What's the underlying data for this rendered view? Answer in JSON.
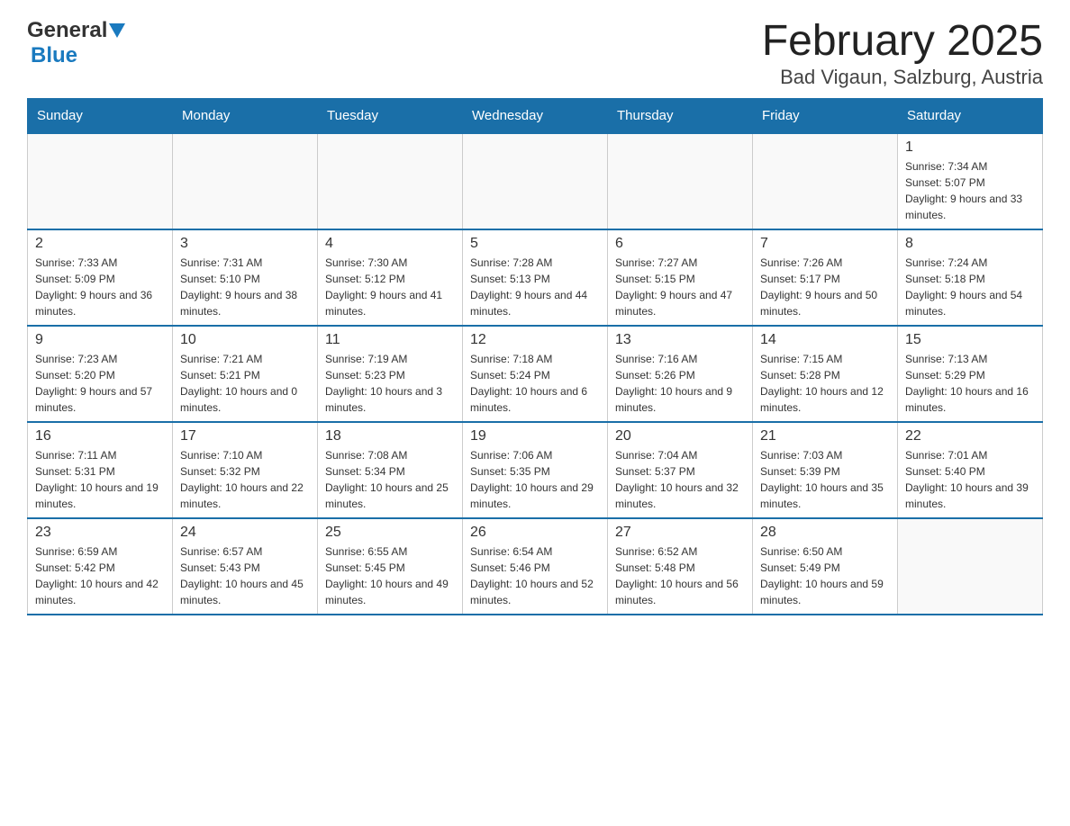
{
  "header": {
    "logo": {
      "general": "General",
      "blue": "Blue"
    },
    "title": "February 2025",
    "subtitle": "Bad Vigaun, Salzburg, Austria"
  },
  "weekdays": [
    "Sunday",
    "Monday",
    "Tuesday",
    "Wednesday",
    "Thursday",
    "Friday",
    "Saturday"
  ],
  "weeks": [
    [
      {
        "day": "",
        "info": ""
      },
      {
        "day": "",
        "info": ""
      },
      {
        "day": "",
        "info": ""
      },
      {
        "day": "",
        "info": ""
      },
      {
        "day": "",
        "info": ""
      },
      {
        "day": "",
        "info": ""
      },
      {
        "day": "1",
        "info": "Sunrise: 7:34 AM\nSunset: 5:07 PM\nDaylight: 9 hours and 33 minutes."
      }
    ],
    [
      {
        "day": "2",
        "info": "Sunrise: 7:33 AM\nSunset: 5:09 PM\nDaylight: 9 hours and 36 minutes."
      },
      {
        "day": "3",
        "info": "Sunrise: 7:31 AM\nSunset: 5:10 PM\nDaylight: 9 hours and 38 minutes."
      },
      {
        "day": "4",
        "info": "Sunrise: 7:30 AM\nSunset: 5:12 PM\nDaylight: 9 hours and 41 minutes."
      },
      {
        "day": "5",
        "info": "Sunrise: 7:28 AM\nSunset: 5:13 PM\nDaylight: 9 hours and 44 minutes."
      },
      {
        "day": "6",
        "info": "Sunrise: 7:27 AM\nSunset: 5:15 PM\nDaylight: 9 hours and 47 minutes."
      },
      {
        "day": "7",
        "info": "Sunrise: 7:26 AM\nSunset: 5:17 PM\nDaylight: 9 hours and 50 minutes."
      },
      {
        "day": "8",
        "info": "Sunrise: 7:24 AM\nSunset: 5:18 PM\nDaylight: 9 hours and 54 minutes."
      }
    ],
    [
      {
        "day": "9",
        "info": "Sunrise: 7:23 AM\nSunset: 5:20 PM\nDaylight: 9 hours and 57 minutes."
      },
      {
        "day": "10",
        "info": "Sunrise: 7:21 AM\nSunset: 5:21 PM\nDaylight: 10 hours and 0 minutes."
      },
      {
        "day": "11",
        "info": "Sunrise: 7:19 AM\nSunset: 5:23 PM\nDaylight: 10 hours and 3 minutes."
      },
      {
        "day": "12",
        "info": "Sunrise: 7:18 AM\nSunset: 5:24 PM\nDaylight: 10 hours and 6 minutes."
      },
      {
        "day": "13",
        "info": "Sunrise: 7:16 AM\nSunset: 5:26 PM\nDaylight: 10 hours and 9 minutes."
      },
      {
        "day": "14",
        "info": "Sunrise: 7:15 AM\nSunset: 5:28 PM\nDaylight: 10 hours and 12 minutes."
      },
      {
        "day": "15",
        "info": "Sunrise: 7:13 AM\nSunset: 5:29 PM\nDaylight: 10 hours and 16 minutes."
      }
    ],
    [
      {
        "day": "16",
        "info": "Sunrise: 7:11 AM\nSunset: 5:31 PM\nDaylight: 10 hours and 19 minutes."
      },
      {
        "day": "17",
        "info": "Sunrise: 7:10 AM\nSunset: 5:32 PM\nDaylight: 10 hours and 22 minutes."
      },
      {
        "day": "18",
        "info": "Sunrise: 7:08 AM\nSunset: 5:34 PM\nDaylight: 10 hours and 25 minutes."
      },
      {
        "day": "19",
        "info": "Sunrise: 7:06 AM\nSunset: 5:35 PM\nDaylight: 10 hours and 29 minutes."
      },
      {
        "day": "20",
        "info": "Sunrise: 7:04 AM\nSunset: 5:37 PM\nDaylight: 10 hours and 32 minutes."
      },
      {
        "day": "21",
        "info": "Sunrise: 7:03 AM\nSunset: 5:39 PM\nDaylight: 10 hours and 35 minutes."
      },
      {
        "day": "22",
        "info": "Sunrise: 7:01 AM\nSunset: 5:40 PM\nDaylight: 10 hours and 39 minutes."
      }
    ],
    [
      {
        "day": "23",
        "info": "Sunrise: 6:59 AM\nSunset: 5:42 PM\nDaylight: 10 hours and 42 minutes."
      },
      {
        "day": "24",
        "info": "Sunrise: 6:57 AM\nSunset: 5:43 PM\nDaylight: 10 hours and 45 minutes."
      },
      {
        "day": "25",
        "info": "Sunrise: 6:55 AM\nSunset: 5:45 PM\nDaylight: 10 hours and 49 minutes."
      },
      {
        "day": "26",
        "info": "Sunrise: 6:54 AM\nSunset: 5:46 PM\nDaylight: 10 hours and 52 minutes."
      },
      {
        "day": "27",
        "info": "Sunrise: 6:52 AM\nSunset: 5:48 PM\nDaylight: 10 hours and 56 minutes."
      },
      {
        "day": "28",
        "info": "Sunrise: 6:50 AM\nSunset: 5:49 PM\nDaylight: 10 hours and 59 minutes."
      },
      {
        "day": "",
        "info": ""
      }
    ]
  ]
}
